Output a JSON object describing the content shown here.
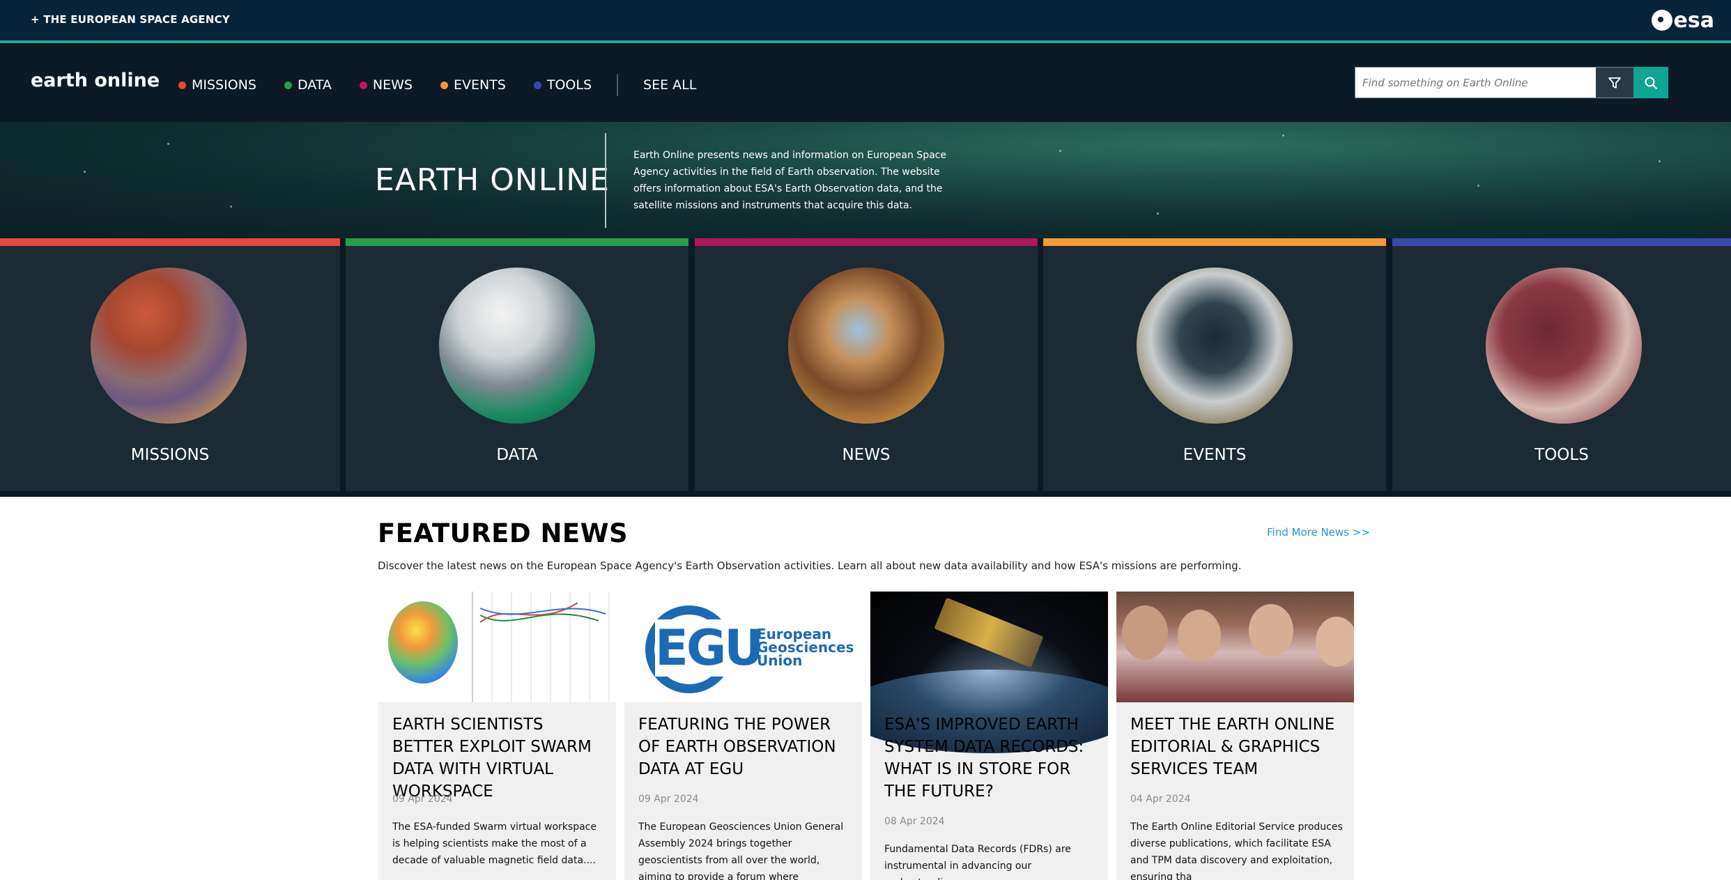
{
  "top_bar": {
    "agency_link": "+ THE EUROPEAN SPACE AGENCY",
    "logo_text": "esa"
  },
  "header": {
    "brand": "earth online",
    "nav": [
      {
        "label": "MISSIONS",
        "color": "#e8483a"
      },
      {
        "label": "DATA",
        "color": "#2a9d4a"
      },
      {
        "label": "NEWS",
        "color": "#c2185b"
      },
      {
        "label": "EVENTS",
        "color": "#f29a38"
      },
      {
        "label": "TOOLS",
        "color": "#3949ab"
      }
    ],
    "see_all": "SEE ALL",
    "search_placeholder": "Find something on Earth Online"
  },
  "hero": {
    "title": "EARTH ONLINE",
    "description": "Earth Online presents news and information on European Space Agency activities in the field of Earth observation. The website offers information about ESA's Earth Observation data, and the satellite missions and instruments that acquire this data."
  },
  "tiles": [
    {
      "label": "MISSIONS",
      "color": "#e8483a"
    },
    {
      "label": "DATA",
      "color": "#2a9d4a"
    },
    {
      "label": "NEWS",
      "color": "#b0165c"
    },
    {
      "label": "EVENTS",
      "color": "#f29a38"
    },
    {
      "label": "TOOLS",
      "color": "#3949ab"
    }
  ],
  "featured": {
    "title": "FEATURED NEWS",
    "find_more": "Find More News >>",
    "description": "Discover the latest news on the European Space Agency's Earth Observation activities. Learn all about new data availability and how ESA's missions are performing.",
    "cards": [
      {
        "title": "EARTH SCIENTISTS BETTER EXPLOIT SWARM DATA WITH VIRTUAL WORKSPACE",
        "date": "09 Apr 2024",
        "excerpt": "The ESA-funded Swarm virtual workspace is helping scientists make the most of a decade of valuable magnetic field data...."
      },
      {
        "title": "FEATURING THE POWER OF EARTH OBSERVATION DATA AT EGU",
        "date": "09 Apr 2024",
        "excerpt": "The European Geosciences Union General Assembly 2024 brings together geoscientists from all over the world, aiming to provide a forum where",
        "logo_main": "EGU",
        "logo_text_1": "European",
        "logo_text_2": "Geosciences",
        "logo_text_3": "Union"
      },
      {
        "title": "ESA'S IMPROVED EARTH SYSTEM DATA RECORDS: WHAT IS IN STORE FOR THE FUTURE?",
        "date": "08 Apr 2024",
        "excerpt": "Fundamental Data Records (FDRs) are instrumental in advancing our understanding"
      },
      {
        "title": "MEET THE EARTH ONLINE EDITORIAL & GRAPHICS SERVICES TEAM",
        "date": "04 Apr 2024",
        "excerpt": "The Earth Online Editorial Service produces diverse publications, which facilitate ESA and TPM data discovery and exploitation, ensuring tha"
      }
    ]
  }
}
